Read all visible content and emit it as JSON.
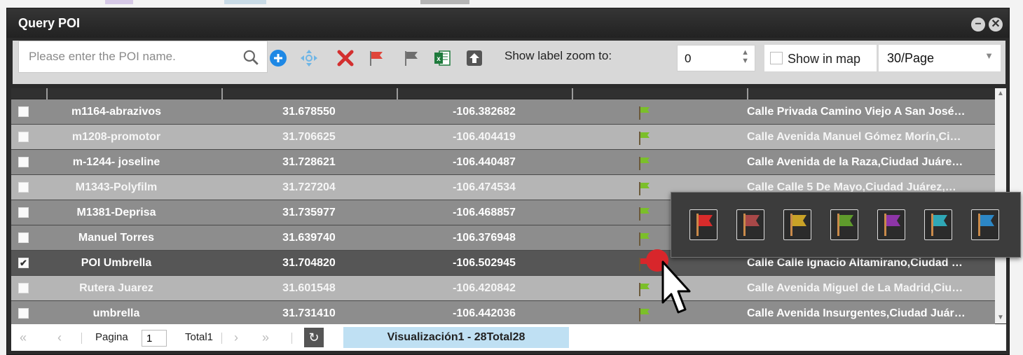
{
  "window": {
    "title": "Query POI",
    "minimize_label": "−",
    "close_label": "✕"
  },
  "toolbar": {
    "search_placeholder": "Please enter the POI name.",
    "zoom_label": "Show label zoom to:",
    "zoom_value": "0",
    "show_in_map_label": "Show in map",
    "show_in_map_checked": false,
    "per_page": "30/Page",
    "icons": [
      "search-icon",
      "add-icon",
      "move-icon",
      "delete-icon",
      "red-flag-icon",
      "gray-flag-icon",
      "excel-export-icon",
      "upload-icon"
    ]
  },
  "rows": [
    {
      "name": "m1164-abrazivos",
      "lat": "31.678550",
      "lng": "-106.382682",
      "address": "Calle Privada Camino Viejo A San José…",
      "checked": false,
      "style": "dark"
    },
    {
      "name": "m1208-promotor",
      "lat": "31.706625",
      "lng": "-106.404419",
      "address": "Calle Avenida Manuel Gómez Morín,Ci…",
      "checked": false,
      "style": "light"
    },
    {
      "name": "m-1244- joseline",
      "lat": "31.728621",
      "lng": "-106.440487",
      "address": "Calle Avenida de la Raza,Ciudad Juáre…",
      "checked": false,
      "style": "dark"
    },
    {
      "name": "M1343-Polyfilm",
      "lat": "31.727204",
      "lng": "-106.474534",
      "address": "Calle Calle 5 De Mayo,Ciudad Juárez,…",
      "checked": false,
      "style": "light"
    },
    {
      "name": "M1381-Deprisa",
      "lat": "31.735977",
      "lng": "-106.468857",
      "address": "",
      "checked": false,
      "style": "dark"
    },
    {
      "name": "Manuel Torres",
      "lat": "31.639740",
      "lng": "-106.376948",
      "address": "",
      "checked": false,
      "style": "dark"
    },
    {
      "name": "POI Umbrella",
      "lat": "31.704820",
      "lng": "-106.502945",
      "address": "Calle Calle Ignacio Altamirano,Ciudad …",
      "checked": true,
      "style": "selected"
    },
    {
      "name": "Rutera Juarez",
      "lat": "31.601548",
      "lng": "-106.420842",
      "address": "Calle Avenida Miguel de La Madrid,Ciu…",
      "checked": false,
      "style": "light"
    },
    {
      "name": "umbrella",
      "lat": "31.731410",
      "lng": "-106.442036",
      "address": "Calle Avenida Insurgentes,Ciudad Juár…",
      "checked": false,
      "style": "dark"
    }
  ],
  "pager": {
    "first": "«",
    "prev": "‹",
    "page_label": "Pagina",
    "page_value": "1",
    "total_label": "Total1",
    "next": "›",
    "last": "»",
    "refresh": "↻",
    "info": "Visualización1 - 28Total28"
  },
  "flag_colors": [
    "#d82b2b",
    "#a84848",
    "#c9a227",
    "#5f9b2c",
    "#8e35a8",
    "#2fa7b5",
    "#2c87c6"
  ],
  "colors": {
    "accent_blue": "#1e88e5",
    "delete_red": "#d32f2f",
    "excel_green": "#1e7a3c",
    "row_flag_green": "#7bbf2a"
  }
}
